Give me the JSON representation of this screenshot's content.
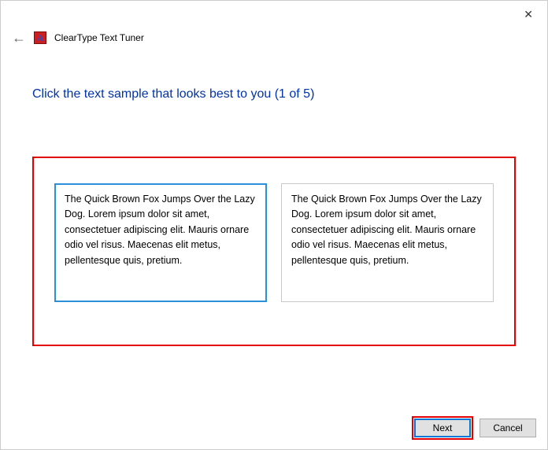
{
  "window": {
    "title": "ClearType Text Tuner"
  },
  "heading": "Click the text sample that looks best to you (1 of 5)",
  "samples": {
    "left": "The Quick Brown Fox Jumps Over the Lazy Dog. Lorem ipsum dolor sit amet, consectetuer adipiscing elit. Mauris ornare odio vel risus. Maecenas elit metus, pellentesque quis, pretium.",
    "right": "The Quick Brown Fox Jumps Over the Lazy Dog. Lorem ipsum dolor sit amet, consectetuer adipiscing elit. Mauris ornare odio vel risus. Maecenas elit metus, pellentesque quis, pretium."
  },
  "buttons": {
    "next": "Next",
    "cancel": "Cancel"
  },
  "icon_letter": "A"
}
